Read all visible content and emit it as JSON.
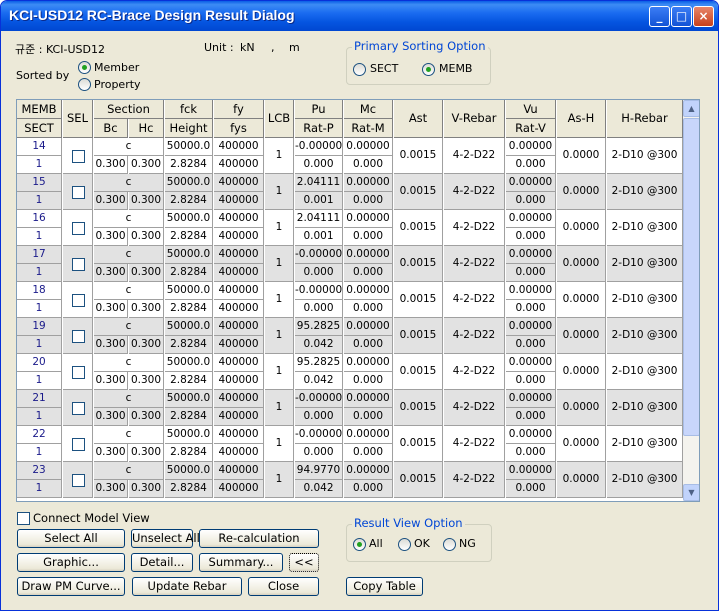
{
  "window": {
    "title": "KCI-USD12 RC-Brace Design Result Dialog"
  },
  "header": {
    "code_label": "규준 : KCI-USD12",
    "unit_label": "Unit :",
    "unit_force": "kN",
    "unit_sep": ",",
    "unit_length": "m",
    "sorted_by_label": "Sorted by",
    "sorted_by_options": [
      "Member",
      "Property"
    ],
    "sorted_by_selected": "Member"
  },
  "primary_sorting": {
    "title": "Primary Sorting Option",
    "options": [
      "SECT",
      "MEMB"
    ],
    "selected": "MEMB"
  },
  "table": {
    "headers": {
      "memb": "MEMB",
      "sect": "SECT",
      "sel": "SEL",
      "section": "Section",
      "bc": "Bc",
      "hc": "Hc",
      "fck": "fck",
      "height": "Height",
      "fy": "fy",
      "fys": "fys",
      "lcb": "LCB",
      "pu": "Pu",
      "rat_p": "Rat-P",
      "mc": "Mc",
      "rat_m": "Rat-M",
      "ast": "Ast",
      "vrebar": "V-Rebar",
      "vu": "Vu",
      "rat_v": "Rat-V",
      "as_h": "As-H",
      "hrebar": "H-Rebar"
    },
    "rows": [
      {
        "memb": "14",
        "sect": "1",
        "section": "c",
        "bc": "0.300",
        "hc": "0.300",
        "fck": "50000.0",
        "height": "2.8284",
        "fy": "400000",
        "fys": "400000",
        "lcb": "1",
        "pu": "-0.00000",
        "rat_p": "0.000",
        "mc": "0.00000",
        "rat_m": "0.000",
        "ast": "0.0015",
        "vrebar": "4-2-D22",
        "vu": "0.00000",
        "rat_v": "0.000",
        "as_h": "0.0000",
        "hrebar": "2-D10 @300"
      },
      {
        "memb": "15",
        "sect": "1",
        "section": "c",
        "bc": "0.300",
        "hc": "0.300",
        "fck": "50000.0",
        "height": "2.8284",
        "fy": "400000",
        "fys": "400000",
        "lcb": "1",
        "pu": "2.04111",
        "rat_p": "0.001",
        "mc": "0.00000",
        "rat_m": "0.000",
        "ast": "0.0015",
        "vrebar": "4-2-D22",
        "vu": "0.00000",
        "rat_v": "0.000",
        "as_h": "0.0000",
        "hrebar": "2-D10 @300"
      },
      {
        "memb": "16",
        "sect": "1",
        "section": "c",
        "bc": "0.300",
        "hc": "0.300",
        "fck": "50000.0",
        "height": "2.8284",
        "fy": "400000",
        "fys": "400000",
        "lcb": "1",
        "pu": "2.04111",
        "rat_p": "0.001",
        "mc": "0.00000",
        "rat_m": "0.000",
        "ast": "0.0015",
        "vrebar": "4-2-D22",
        "vu": "0.00000",
        "rat_v": "0.000",
        "as_h": "0.0000",
        "hrebar": "2-D10 @300"
      },
      {
        "memb": "17",
        "sect": "1",
        "section": "c",
        "bc": "0.300",
        "hc": "0.300",
        "fck": "50000.0",
        "height": "2.8284",
        "fy": "400000",
        "fys": "400000",
        "lcb": "1",
        "pu": "-0.00000",
        "rat_p": "0.000",
        "mc": "0.00000",
        "rat_m": "0.000",
        "ast": "0.0015",
        "vrebar": "4-2-D22",
        "vu": "0.00000",
        "rat_v": "0.000",
        "as_h": "0.0000",
        "hrebar": "2-D10 @300"
      },
      {
        "memb": "18",
        "sect": "1",
        "section": "c",
        "bc": "0.300",
        "hc": "0.300",
        "fck": "50000.0",
        "height": "2.8284",
        "fy": "400000",
        "fys": "400000",
        "lcb": "1",
        "pu": "-0.00000",
        "rat_p": "0.000",
        "mc": "0.00000",
        "rat_m": "0.000",
        "ast": "0.0015",
        "vrebar": "4-2-D22",
        "vu": "0.00000",
        "rat_v": "0.000",
        "as_h": "0.0000",
        "hrebar": "2-D10 @300"
      },
      {
        "memb": "19",
        "sect": "1",
        "section": "c",
        "bc": "0.300",
        "hc": "0.300",
        "fck": "50000.0",
        "height": "2.8284",
        "fy": "400000",
        "fys": "400000",
        "lcb": "1",
        "pu": "95.2825",
        "rat_p": "0.042",
        "mc": "0.00000",
        "rat_m": "0.000",
        "ast": "0.0015",
        "vrebar": "4-2-D22",
        "vu": "0.00000",
        "rat_v": "0.000",
        "as_h": "0.0000",
        "hrebar": "2-D10 @300"
      },
      {
        "memb": "20",
        "sect": "1",
        "section": "c",
        "bc": "0.300",
        "hc": "0.300",
        "fck": "50000.0",
        "height": "2.8284",
        "fy": "400000",
        "fys": "400000",
        "lcb": "1",
        "pu": "95.2825",
        "rat_p": "0.042",
        "mc": "0.00000",
        "rat_m": "0.000",
        "ast": "0.0015",
        "vrebar": "4-2-D22",
        "vu": "0.00000",
        "rat_v": "0.000",
        "as_h": "0.0000",
        "hrebar": "2-D10 @300"
      },
      {
        "memb": "21",
        "sect": "1",
        "section": "c",
        "bc": "0.300",
        "hc": "0.300",
        "fck": "50000.0",
        "height": "2.8284",
        "fy": "400000",
        "fys": "400000",
        "lcb": "1",
        "pu": "-0.00000",
        "rat_p": "0.000",
        "mc": "0.00000",
        "rat_m": "0.000",
        "ast": "0.0015",
        "vrebar": "4-2-D22",
        "vu": "0.00000",
        "rat_v": "0.000",
        "as_h": "0.0000",
        "hrebar": "2-D10 @300"
      },
      {
        "memb": "22",
        "sect": "1",
        "section": "c",
        "bc": "0.300",
        "hc": "0.300",
        "fck": "50000.0",
        "height": "2.8284",
        "fy": "400000",
        "fys": "400000",
        "lcb": "1",
        "pu": "-0.00000",
        "rat_p": "0.000",
        "mc": "0.00000",
        "rat_m": "0.000",
        "ast": "0.0015",
        "vrebar": "4-2-D22",
        "vu": "0.00000",
        "rat_v": "0.000",
        "as_h": "0.0000",
        "hrebar": "2-D10 @300"
      },
      {
        "memb": "23",
        "sect": "1",
        "section": "c",
        "bc": "0.300",
        "hc": "0.300",
        "fck": "50000.0",
        "height": "2.8284",
        "fy": "400000",
        "fys": "400000",
        "lcb": "1",
        "pu": "94.9770",
        "rat_p": "0.042",
        "mc": "0.00000",
        "rat_m": "0.000",
        "ast": "0.0015",
        "vrebar": "4-2-D22",
        "vu": "0.00000",
        "rat_v": "0.000",
        "as_h": "0.0000",
        "hrebar": "2-D10 @300"
      }
    ]
  },
  "footer": {
    "connect_model_view": "Connect Model View",
    "select_all": "Select All",
    "unselect_all": "Unselect All",
    "recalculation": "Re-calculation",
    "graphic": "Graphic...",
    "detail": "Detail...",
    "summary": "Summary...",
    "collapse": "<<",
    "draw_pm": "Draw PM Curve...",
    "update_rebar": "Update Rebar",
    "close": "Close",
    "copy_table": "Copy Table"
  },
  "result_view": {
    "title": "Result View Option",
    "options": [
      "All",
      "OK",
      "NG"
    ],
    "selected": "All"
  },
  "colors": {
    "row_alt": "#e2e2e2",
    "row_even": "#ffffff",
    "accent_blue": "#0046d5"
  }
}
